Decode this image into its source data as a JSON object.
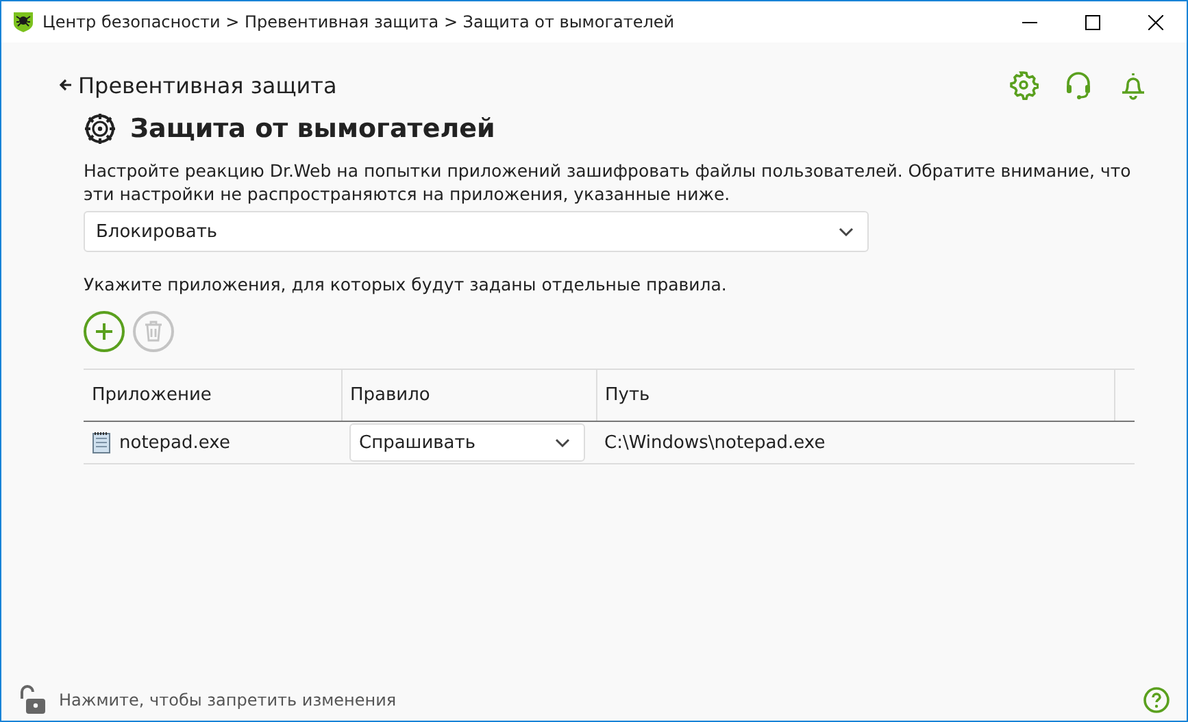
{
  "window": {
    "title": "Центр безопасности > Превентивная защита > Защита от вымогателей"
  },
  "back_link": "Превентивная защита",
  "heading": "Защита от вымогателей",
  "description": "Настройте реакцию Dr.Web на попытки приложений зашифровать файлы пользователей. Обратите внимание, что эти настройки не распространяются на приложения, указанные ниже.",
  "action_select": {
    "value": "Блокировать"
  },
  "apps_label": "Укажите приложения, для которых будут заданы отдельные правила.",
  "toolbar": [
    {
      "kind": "add",
      "disabled": false
    },
    {
      "kind": "delete",
      "disabled": true
    }
  ],
  "table": {
    "columns": [
      "Приложение",
      "Правило",
      "Путь"
    ],
    "rows": [
      {
        "app": "notepad.exe",
        "rule": "Спрашивать",
        "path": "C:\\Windows\\notepad.exe"
      }
    ]
  },
  "status_bar": {
    "lock_text": "Нажмите, чтобы запретить изменения"
  }
}
